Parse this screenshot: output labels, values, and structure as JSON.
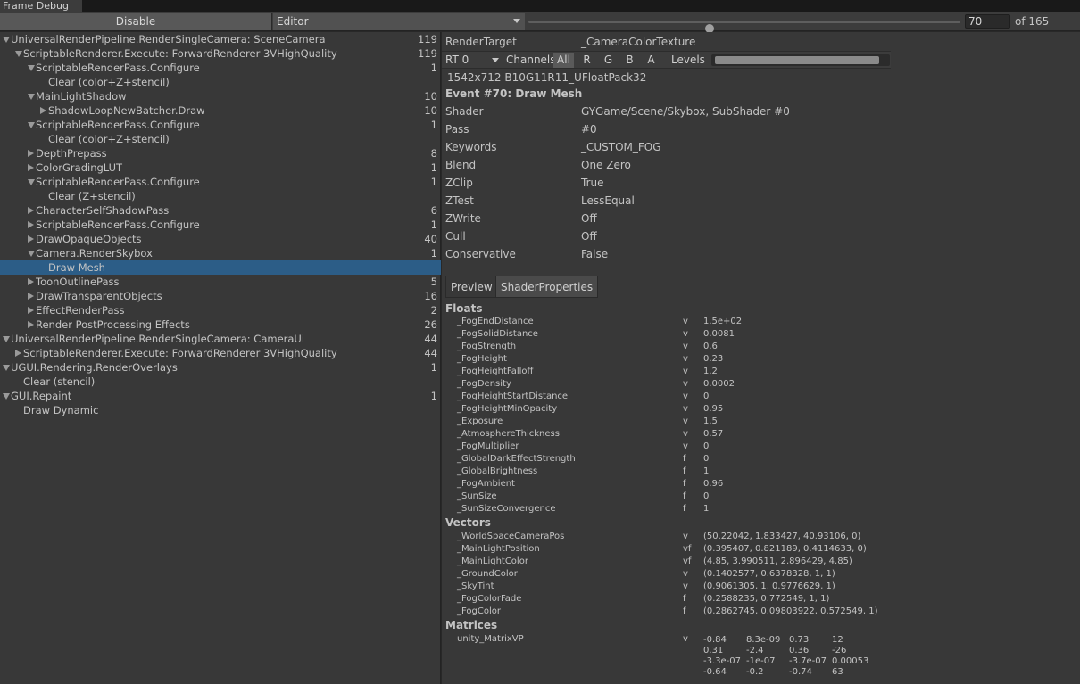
{
  "window": {
    "tab_title": "Frame Debug"
  },
  "toolbar": {
    "disable_label": "Disable",
    "target_label": "Editor",
    "frame_value": "70",
    "frame_total_label": "of 165",
    "slider_fraction": 0.42
  },
  "tree": [
    {
      "label": "UniversalRenderPipeline.RenderSingleCamera: SceneCamera",
      "count": "119",
      "depth": 0,
      "expand": "down"
    },
    {
      "label": "ScriptableRenderer.Execute: ForwardRenderer 3VHighQuality",
      "count": "119",
      "depth": 1,
      "expand": "down"
    },
    {
      "label": "ScriptableRenderPass.Configure",
      "count": "1",
      "depth": 2,
      "expand": "down"
    },
    {
      "label": "Clear (color+Z+stencil)",
      "count": "",
      "depth": 3,
      "expand": "none"
    },
    {
      "label": "MainLightShadow",
      "count": "10",
      "depth": 2,
      "expand": "down"
    },
    {
      "label": "ShadowLoopNewBatcher.Draw",
      "count": "10",
      "depth": 3,
      "expand": "right"
    },
    {
      "label": "ScriptableRenderPass.Configure",
      "count": "1",
      "depth": 2,
      "expand": "down"
    },
    {
      "label": "Clear (color+Z+stencil)",
      "count": "",
      "depth": 3,
      "expand": "none"
    },
    {
      "label": "DepthPrepass",
      "count": "8",
      "depth": 2,
      "expand": "right"
    },
    {
      "label": "ColorGradingLUT",
      "count": "1",
      "depth": 2,
      "expand": "right"
    },
    {
      "label": "ScriptableRenderPass.Configure",
      "count": "1",
      "depth": 2,
      "expand": "down"
    },
    {
      "label": "Clear (Z+stencil)",
      "count": "",
      "depth": 3,
      "expand": "none"
    },
    {
      "label": "CharacterSelfShadowPass",
      "count": "6",
      "depth": 2,
      "expand": "right"
    },
    {
      "label": "ScriptableRenderPass.Configure",
      "count": "1",
      "depth": 2,
      "expand": "right"
    },
    {
      "label": "DrawOpaqueObjects",
      "count": "40",
      "depth": 2,
      "expand": "right"
    },
    {
      "label": "Camera.RenderSkybox",
      "count": "1",
      "depth": 2,
      "expand": "down"
    },
    {
      "label": "Draw Mesh",
      "count": "",
      "depth": 3,
      "expand": "none",
      "selected": true
    },
    {
      "label": "ToonOutlinePass",
      "count": "5",
      "depth": 2,
      "expand": "right"
    },
    {
      "label": "DrawTransparentObjects",
      "count": "16",
      "depth": 2,
      "expand": "right"
    },
    {
      "label": "EffectRenderPass",
      "count": "2",
      "depth": 2,
      "expand": "right"
    },
    {
      "label": "Render PostProcessing Effects",
      "count": "26",
      "depth": 2,
      "expand": "right"
    },
    {
      "label": "UniversalRenderPipeline.RenderSingleCamera: CameraUi",
      "count": "44",
      "depth": 0,
      "expand": "down"
    },
    {
      "label": "ScriptableRenderer.Execute: ForwardRenderer 3VHighQuality",
      "count": "44",
      "depth": 1,
      "expand": "right"
    },
    {
      "label": "UGUI.Rendering.RenderOverlays",
      "count": "1",
      "depth": 0,
      "expand": "down"
    },
    {
      "label": "Clear (stencil)",
      "count": "",
      "depth": 1,
      "expand": "none"
    },
    {
      "label": "GUI.Repaint",
      "count": "1",
      "depth": 0,
      "expand": "down"
    },
    {
      "label": "Draw Dynamic",
      "count": "",
      "depth": 1,
      "expand": "none"
    }
  ],
  "details": {
    "render_target_label": "RenderTarget",
    "render_target_value": "_CameraColorTexture",
    "rt_select": "RT 0",
    "channels_label": "Channels",
    "channels": [
      "All",
      "R",
      "G",
      "B",
      "A"
    ],
    "active_channel": "All",
    "levels_label": "Levels",
    "levels_fraction": 0.96,
    "format": "1542x712 B10G11R11_UFloatPack32",
    "event_title": "Event #70: Draw Mesh",
    "properties": [
      {
        "key": "Shader",
        "value": "GYGame/Scene/Skybox, SubShader #0"
      },
      {
        "key": "Pass",
        "value": "#0"
      },
      {
        "key": "Keywords",
        "value": "_CUSTOM_FOG"
      },
      {
        "key": "Blend",
        "value": "One Zero"
      },
      {
        "key": "ZClip",
        "value": "True"
      },
      {
        "key": "ZTest",
        "value": "LessEqual"
      },
      {
        "key": "ZWrite",
        "value": "Off"
      },
      {
        "key": "Cull",
        "value": "Off"
      },
      {
        "key": "Conservative",
        "value": "False"
      }
    ],
    "tabs": [
      "Preview",
      "ShaderProperties"
    ],
    "active_tab": "ShaderProperties"
  },
  "shader_properties": {
    "floats_title": "Floats",
    "floats": [
      {
        "name": "_FogEndDistance",
        "type": "v",
        "value": "1.5e+02"
      },
      {
        "name": "_FogSolidDistance",
        "type": "v",
        "value": "0.0081"
      },
      {
        "name": "_FogStrength",
        "type": "v",
        "value": "0.6"
      },
      {
        "name": "_FogHeight",
        "type": "v",
        "value": "0.23"
      },
      {
        "name": "_FogHeightFalloff",
        "type": "v",
        "value": "1.2"
      },
      {
        "name": "_FogDensity",
        "type": "v",
        "value": "0.0002"
      },
      {
        "name": "_FogHeightStartDistance",
        "type": "v",
        "value": "0"
      },
      {
        "name": "_FogHeightMinOpacity",
        "type": "v",
        "value": "0.95"
      },
      {
        "name": "_Exposure",
        "type": "v",
        "value": "1.5"
      },
      {
        "name": "_AtmosphereThickness",
        "type": "v",
        "value": "0.57"
      },
      {
        "name": "_FogMultiplier",
        "type": "v",
        "value": "0"
      },
      {
        "name": "_GlobalDarkEffectStrength",
        "type": "f",
        "value": "0"
      },
      {
        "name": "_GlobalBrightness",
        "type": "f",
        "value": "1"
      },
      {
        "name": "_FogAmbient",
        "type": "f",
        "value": "0.96"
      },
      {
        "name": "_SunSize",
        "type": "f",
        "value": "0"
      },
      {
        "name": "_SunSizeConvergence",
        "type": "f",
        "value": "1"
      }
    ],
    "vectors_title": "Vectors",
    "vectors": [
      {
        "name": "_WorldSpaceCameraPos",
        "type": "v",
        "value": "(50.22042, 1.833427, 40.93106, 0)"
      },
      {
        "name": "_MainLightPosition",
        "type": "vf",
        "value": "(0.395407, 0.821189, 0.4114633, 0)"
      },
      {
        "name": "_MainLightColor",
        "type": "vf",
        "value": "(4.85, 3.990511, 2.896429, 4.85)"
      },
      {
        "name": "_GroundColor",
        "type": "v",
        "value": "(0.1402577, 0.6378328, 1, 1)"
      },
      {
        "name": "_SkyTint",
        "type": "v",
        "value": "(0.9061305, 1, 0.9776629, 1)"
      },
      {
        "name": "_FogColorFade",
        "type": "f",
        "value": "(0.2588235, 0.772549, 1, 1)"
      },
      {
        "name": "_FogColor",
        "type": "f",
        "value": "(0.2862745, 0.09803922, 0.572549, 1)"
      }
    ],
    "matrices_title": "Matrices",
    "matrices": [
      {
        "name": "unity_MatrixVP",
        "type": "v",
        "rows": [
          [
            "-0.84",
            "8.3e-09",
            "0.73",
            "12"
          ],
          [
            "0.31",
            "-2.4",
            "0.36",
            "-26"
          ],
          [
            "-3.3e-07",
            "-1e-07",
            "-3.7e-07",
            "0.00053"
          ],
          [
            "-0.64",
            "-0.2",
            "-0.74",
            "63"
          ]
        ]
      }
    ]
  },
  "colors": {
    "background": "#383838",
    "selection": "#2c5d87",
    "toolbar": "#3c3c3c"
  }
}
